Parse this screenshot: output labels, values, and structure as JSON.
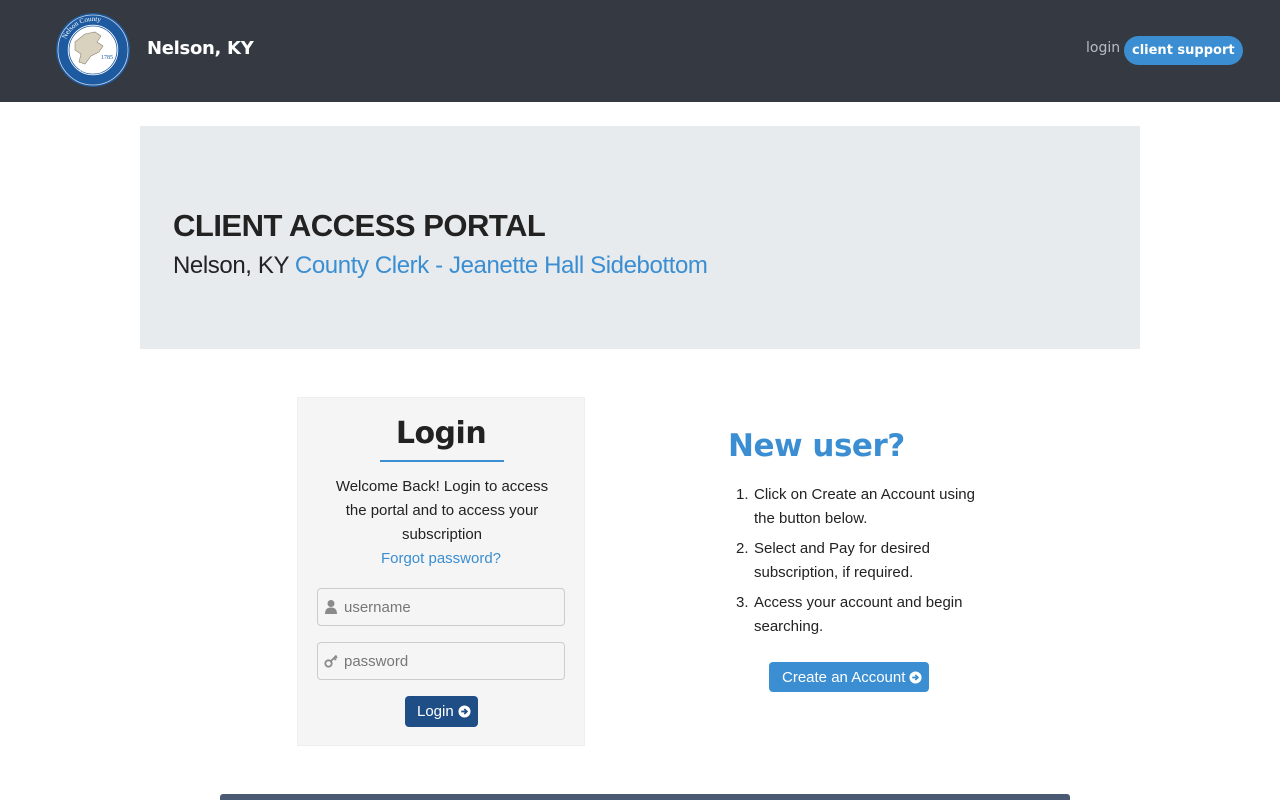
{
  "header": {
    "site_name": "Nelson, KY",
    "seal": {
      "top_text": "Nelson County",
      "bottom_text": "Kentucky",
      "year": "1785"
    },
    "nav": {
      "login_label": "login",
      "support_label": "client support"
    }
  },
  "banner": {
    "title": "CLIENT ACCESS PORTAL",
    "location": "Nelson, KY",
    "office_link": "County Clerk - Jeanette Hall Sidebottom"
  },
  "login": {
    "heading": "Login",
    "welcome_text": "Welcome Back! Login to access the portal and to access your subscription",
    "forgot_label": "Forgot password?",
    "username_placeholder": "username",
    "password_placeholder": "password",
    "submit_label": "Login"
  },
  "new_user": {
    "heading": "New user?",
    "steps": [
      {
        "num": "1.",
        "text": "Click on Create an Account using the button below."
      },
      {
        "num": "2.",
        "text": "Select and Pay for desired subscription, if required."
      },
      {
        "num": "3.",
        "text": "Access your account and begin searching."
      }
    ],
    "create_label": "Create an Account"
  },
  "colors": {
    "header_bg": "#353a42",
    "accent": "#3a8ed1",
    "login_button": "#1f4e87",
    "banner_bg": "#e8ebee"
  }
}
